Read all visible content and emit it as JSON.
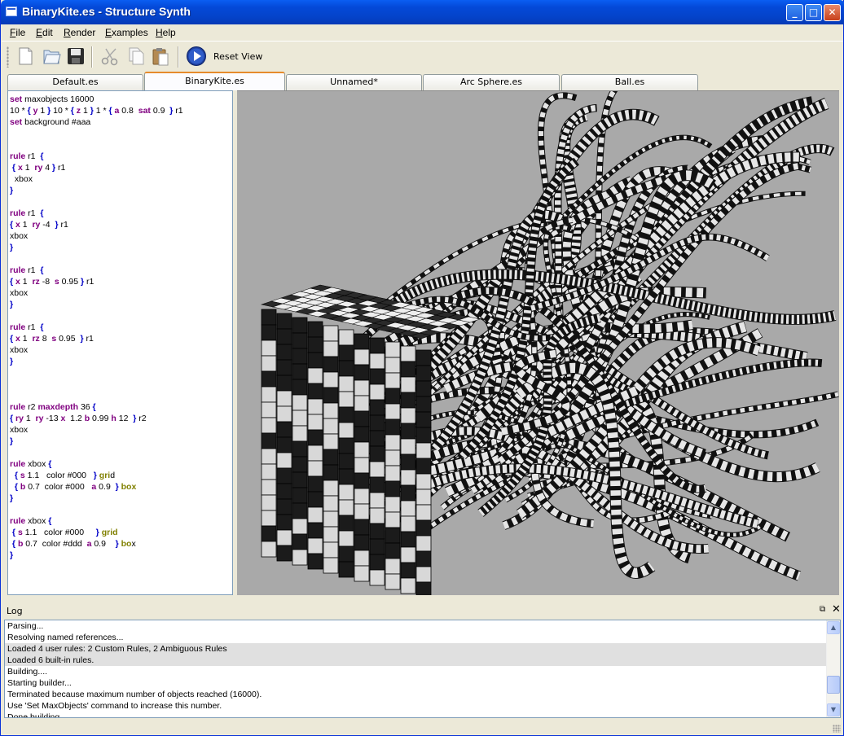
{
  "window": {
    "title": "BinaryKite.es - Structure Synth"
  },
  "menubar": {
    "items": [
      {
        "label": "File",
        "u": "F",
        "rest": "ile"
      },
      {
        "label": "Edit",
        "u": "E",
        "rest": "dit"
      },
      {
        "label": "Render",
        "u": "R",
        "rest": "ender"
      },
      {
        "label": "Examples",
        "u": "E",
        "rest": "xamples"
      },
      {
        "label": "Help",
        "u": "H",
        "rest": "elp"
      }
    ]
  },
  "toolbar": {
    "reset_view_label": "Reset View"
  },
  "tabs": [
    {
      "label": "Default.es",
      "active": false
    },
    {
      "label": "BinaryKite.es",
      "active": true
    },
    {
      "label": "Unnamed*",
      "active": false
    },
    {
      "label": "Arc Sphere.es",
      "active": false
    },
    {
      "label": "Ball.es",
      "active": false
    }
  ],
  "editor": {
    "lines": [
      [
        [
          "kw",
          "set"
        ],
        [
          "t",
          " maxobjects 16000"
        ]
      ],
      [
        [
          "t",
          "10 * "
        ],
        [
          "br",
          "{"
        ],
        [
          "t",
          " "
        ],
        [
          "kw",
          "y"
        ],
        [
          "t",
          " 1 "
        ],
        [
          "br",
          "}"
        ],
        [
          "t",
          " 10 * "
        ],
        [
          "br",
          "{"
        ],
        [
          "t",
          " "
        ],
        [
          "kw",
          "z"
        ],
        [
          "t",
          " 1 "
        ],
        [
          "br",
          "}"
        ],
        [
          "t",
          " 1 * "
        ],
        [
          "br",
          "{"
        ],
        [
          "t",
          " "
        ],
        [
          "kw",
          "a"
        ],
        [
          "t",
          " 0.8  "
        ],
        [
          "kw",
          "sat"
        ],
        [
          "t",
          " 0.9  "
        ],
        [
          "br",
          "}"
        ],
        [
          "t",
          " r1"
        ]
      ],
      [
        [
          "kw",
          "set"
        ],
        [
          "t",
          " background #aaa"
        ]
      ],
      [],
      [],
      [
        [
          "kw",
          "rule"
        ],
        [
          "t",
          " r1  "
        ],
        [
          "br",
          "{"
        ]
      ],
      [
        [
          "t",
          " "
        ],
        [
          "br",
          "{"
        ],
        [
          "t",
          " "
        ],
        [
          "kw",
          "x"
        ],
        [
          "t",
          " 1  "
        ],
        [
          "kw",
          "ry"
        ],
        [
          "t",
          " 4 "
        ],
        [
          "br",
          "}"
        ],
        [
          "t",
          " r1"
        ]
      ],
      [
        [
          "t",
          "  xbox"
        ]
      ],
      [
        [
          "br",
          "}"
        ]
      ],
      [],
      [
        [
          "kw",
          "rule"
        ],
        [
          "t",
          " r1  "
        ],
        [
          "br",
          "{"
        ]
      ],
      [
        [
          "br",
          "{"
        ],
        [
          "t",
          " "
        ],
        [
          "kw",
          "x"
        ],
        [
          "t",
          " 1  "
        ],
        [
          "kw",
          "ry"
        ],
        [
          "t",
          " -4  "
        ],
        [
          "br",
          "}"
        ],
        [
          "t",
          " r1"
        ]
      ],
      [
        [
          "t",
          "xbox"
        ]
      ],
      [
        [
          "br",
          "}"
        ]
      ],
      [],
      [
        [
          "kw",
          "rule"
        ],
        [
          "t",
          " r1  "
        ],
        [
          "br",
          "{"
        ]
      ],
      [
        [
          "br",
          "{"
        ],
        [
          "t",
          " "
        ],
        [
          "kw",
          "x"
        ],
        [
          "t",
          " 1  "
        ],
        [
          "kw",
          "rz"
        ],
        [
          "t",
          " -8  "
        ],
        [
          "kw",
          "s"
        ],
        [
          "t",
          " 0.95 "
        ],
        [
          "br",
          "}"
        ],
        [
          "t",
          " r1"
        ]
      ],
      [
        [
          "t",
          "xbox"
        ]
      ],
      [
        [
          "br",
          "}"
        ]
      ],
      [],
      [
        [
          "kw",
          "rule"
        ],
        [
          "t",
          " r1  "
        ],
        [
          "br",
          "{"
        ]
      ],
      [
        [
          "br",
          "{"
        ],
        [
          "t",
          " "
        ],
        [
          "kw",
          "x"
        ],
        [
          "t",
          " 1  "
        ],
        [
          "kw",
          "rz"
        ],
        [
          "t",
          " 8  "
        ],
        [
          "kw",
          "s"
        ],
        [
          "t",
          " 0.95  "
        ],
        [
          "br",
          "}"
        ],
        [
          "t",
          " r1"
        ]
      ],
      [
        [
          "t",
          "xbox"
        ]
      ],
      [
        [
          "br",
          "}"
        ]
      ],
      [],
      [],
      [],
      [
        [
          "kw",
          "rule"
        ],
        [
          "t",
          " r2 "
        ],
        [
          "kw",
          "maxdepth"
        ],
        [
          "t",
          " 36 "
        ],
        [
          "br",
          "{"
        ]
      ],
      [
        [
          "br",
          "{"
        ],
        [
          "t",
          " "
        ],
        [
          "kw",
          "ry"
        ],
        [
          "t",
          " 1  "
        ],
        [
          "kw",
          "ry"
        ],
        [
          "t",
          " -13 "
        ],
        [
          "kw",
          "x"
        ],
        [
          "t",
          "  1.2 "
        ],
        [
          "kw",
          "b"
        ],
        [
          "t",
          " 0.99 "
        ],
        [
          "kw",
          "h"
        ],
        [
          "t",
          " 12  "
        ],
        [
          "br",
          "}"
        ],
        [
          "t",
          " r2"
        ]
      ],
      [
        [
          "t",
          "xbox"
        ]
      ],
      [
        [
          "br",
          "}"
        ]
      ],
      [],
      [
        [
          "kw",
          "rule"
        ],
        [
          "t",
          " xbox "
        ],
        [
          "br",
          "{"
        ]
      ],
      [
        [
          "t",
          "  "
        ],
        [
          "br",
          "{"
        ],
        [
          "t",
          " "
        ],
        [
          "kw",
          "s"
        ],
        [
          "t",
          " 1.1   color #000   "
        ],
        [
          "br",
          "}"
        ],
        [
          "t",
          " "
        ],
        [
          "ol",
          "gri"
        ],
        [
          "t",
          "d"
        ]
      ],
      [
        [
          "t",
          "  "
        ],
        [
          "br",
          "{"
        ],
        [
          "t",
          " "
        ],
        [
          "kw",
          "b"
        ],
        [
          "t",
          " 0.7  color #000   "
        ],
        [
          "kw",
          "a"
        ],
        [
          "t",
          " 0.9  "
        ],
        [
          "br",
          "}"
        ],
        [
          "t",
          " "
        ],
        [
          "ol",
          "box"
        ]
      ],
      [
        [
          "br",
          "}"
        ]
      ],
      [],
      [
        [
          "kw",
          "rule"
        ],
        [
          "t",
          " xbox "
        ],
        [
          "br",
          "{"
        ]
      ],
      [
        [
          "t",
          " "
        ],
        [
          "br",
          "{"
        ],
        [
          "t",
          " "
        ],
        [
          "kw",
          "s"
        ],
        [
          "t",
          " 1.1   color #000     "
        ],
        [
          "br",
          "}"
        ],
        [
          "t",
          " "
        ],
        [
          "ol",
          "grid"
        ]
      ],
      [
        [
          "t",
          " "
        ],
        [
          "br",
          "{"
        ],
        [
          "t",
          " "
        ],
        [
          "kw",
          "b"
        ],
        [
          "t",
          " 0.7  color #ddd  "
        ],
        [
          "kw",
          "a"
        ],
        [
          "t",
          " 0.9    "
        ],
        [
          "br",
          "}"
        ],
        [
          "t",
          " "
        ],
        [
          "ol",
          "bo"
        ],
        [
          "t",
          "x"
        ]
      ],
      [
        [
          "br",
          "}"
        ]
      ]
    ]
  },
  "log": {
    "title": "Log",
    "lines": [
      {
        "text": "Parsing...",
        "hl": false
      },
      {
        "text": "Resolving named references...",
        "hl": false
      },
      {
        "text": "Loaded 4 user rules: 2 Custom Rules, 2 Ambiguous Rules",
        "hl": true
      },
      {
        "text": "Loaded 6 built-in rules.",
        "hl": true
      },
      {
        "text": "Building....",
        "hl": false
      },
      {
        "text": "Starting builder...",
        "hl": false
      },
      {
        "text": "Terminated because maximum number of objects reached (16000).",
        "hl": false
      },
      {
        "text": "Use 'Set MaxObjects' command to increase this number.",
        "hl": false
      },
      {
        "text": "Done building...",
        "hl": false
      }
    ]
  },
  "colors": {
    "viewport_background": "#a9a9a9",
    "keyword": "#800080",
    "brace": "#0000c8",
    "primitive": "#808000"
  }
}
